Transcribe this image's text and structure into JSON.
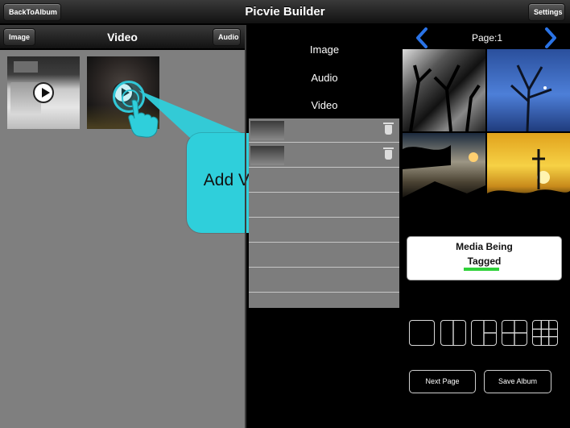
{
  "app": {
    "title": "Picvie Builder"
  },
  "topbar": {
    "back_label": "BackToAlbum",
    "settings_label": "Settings"
  },
  "left_panel": {
    "title": "Video",
    "image_button": "Image",
    "audio_button": "Audio",
    "thumbnails": [
      {
        "kind": "video",
        "icon": "play-icon"
      },
      {
        "kind": "video",
        "icon": "play-icon",
        "selected": true
      }
    ]
  },
  "callout": {
    "text": "Add Video to page",
    "color": "#2fcfdb"
  },
  "media_menu": {
    "items": [
      "Image",
      "Audio",
      "Video"
    ]
  },
  "media_list": {
    "rows": [
      {
        "has_media": true
      },
      {
        "has_media": true
      },
      {
        "has_media": false
      },
      {
        "has_media": false
      },
      {
        "has_media": false
      },
      {
        "has_media": false
      },
      {
        "has_media": false
      }
    ]
  },
  "page": {
    "label": "Page:1",
    "prev_icon": "chevron-left-icon",
    "next_icon": "chevron-right-icon"
  },
  "tag_box": {
    "line1": "Media Being",
    "line2": "Tagged",
    "accent": "#2fd23a"
  },
  "layouts": [
    "layout-single",
    "layout-two-columns",
    "layout-three-panel",
    "layout-four-grid",
    "layout-nine-grid"
  ],
  "actions": {
    "next_page": "Next Page",
    "save_album": "Save Album"
  }
}
